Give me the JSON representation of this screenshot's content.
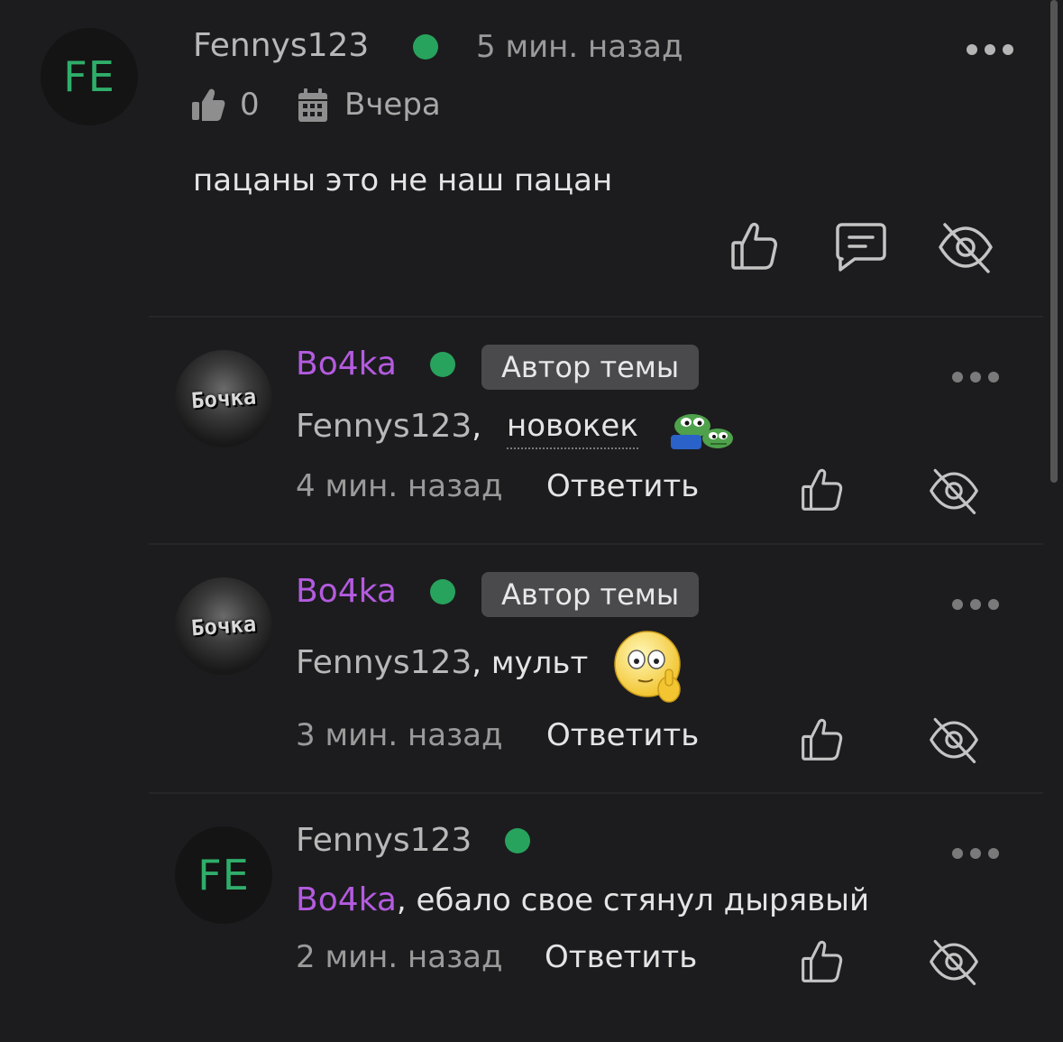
{
  "colors": {
    "background": "#1c1c1e",
    "online": "#27a35d",
    "author_name": "#b45be0",
    "avatar_initials": "#2fae6a",
    "badge_bg": "#4a4a4c"
  },
  "main_comment": {
    "avatar_initials": "FE",
    "author": "Fennys123",
    "time": "5 мин. назад",
    "likes": "0",
    "date": "Вчера",
    "text": "пацаны это не наш пацан"
  },
  "replies": [
    {
      "avatar_text": "Бочка",
      "author": "Bo4ka",
      "badge": "Автор темы",
      "mention": "Fennys123",
      "separator": ",",
      "text": "новокек",
      "emoji": "pepe-frog-emoji",
      "time": "4 мин. назад",
      "reply_label": "Ответить"
    },
    {
      "avatar_text": "Бочка",
      "author": "Bo4ka",
      "badge": "Автор темы",
      "mention": "Fennys123",
      "text": ", мульт",
      "emoji": "thinking-smiley-emoji",
      "time": "3 мин. назад",
      "reply_label": "Ответить"
    },
    {
      "avatar_initials": "FE",
      "author": "Fennys123",
      "mention": "Bo4ka",
      "text": ", ебало свое стянул дырявый",
      "time": "2 мин. назад",
      "reply_label": "Ответить"
    }
  ]
}
